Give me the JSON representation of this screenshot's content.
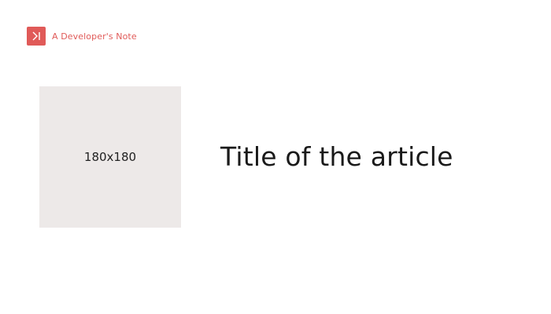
{
  "header": {
    "logo_icon": "skip-forward-icon",
    "site_name": "A Developer's Note"
  },
  "article": {
    "thumbnail_placeholder": "180x180",
    "title": "Title of the article"
  },
  "colors": {
    "accent": "#e05a58",
    "thumbnail_bg": "#ede9e8",
    "text": "#1a1a1a"
  }
}
